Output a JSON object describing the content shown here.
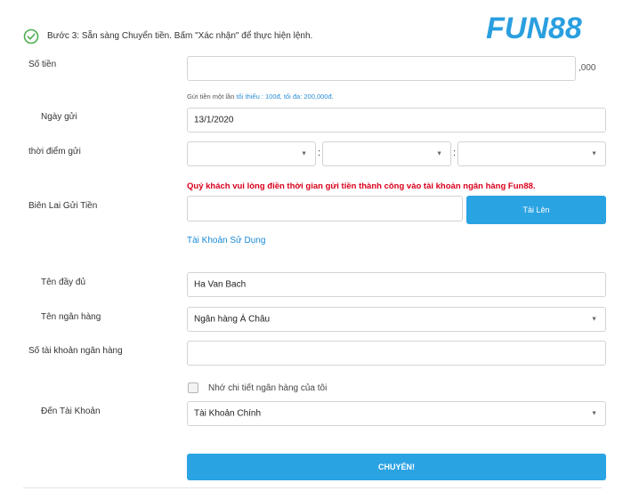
{
  "header": {
    "step_text": "Bước 3: Sẵn sàng Chuyển tiền. Bấm \"Xác nhận\" để thực hiện lệnh.",
    "logo_text": "FUN88",
    "logo_color": "#2a9fe0",
    "check_color": "#4caf50"
  },
  "form": {
    "amount": {
      "label": "Số tiền",
      "value": "",
      "suffix": ",000"
    },
    "amount_hint": {
      "prefix": "Gửi tiền một lần ",
      "highlight": "tối thiểu :  100đ, tối đa: 200,000đ."
    },
    "deposit_date": {
      "label": "Ngày gửi",
      "value": "13/1/2020"
    },
    "deposit_time": {
      "label": "thời điểm gửi",
      "separator": ":",
      "hour": "",
      "minute": "",
      "second": ""
    },
    "warning": "Quý khách vui lòng điền thời gian gửi tiền thành công vào tài khoản ngân hàng Fun88.",
    "receipt": {
      "label": "Biên Lai Gửi Tiền",
      "value": "",
      "upload_label": "Tải Lên"
    },
    "account_link": "Tài Khoản Sử Dụng",
    "full_name": {
      "label": "Tên đầy đủ",
      "value": "Ha Van Bach"
    },
    "bank_name": {
      "label": "Tên ngân hàng",
      "value": "Ngân hàng Á Châu"
    },
    "account_number": {
      "label": "Số tài khoản ngân hàng",
      "value": ""
    },
    "remember": {
      "label": "Nhớ chi tiết ngân hàng của tôi",
      "checked": false
    },
    "to_account": {
      "label": "Đến Tài Khoản",
      "value": "Tài Khoản Chính"
    },
    "submit_label": "CHUYỂN!",
    "accent_color": "#2aa3e3",
    "warning_color": "#d9001b"
  }
}
